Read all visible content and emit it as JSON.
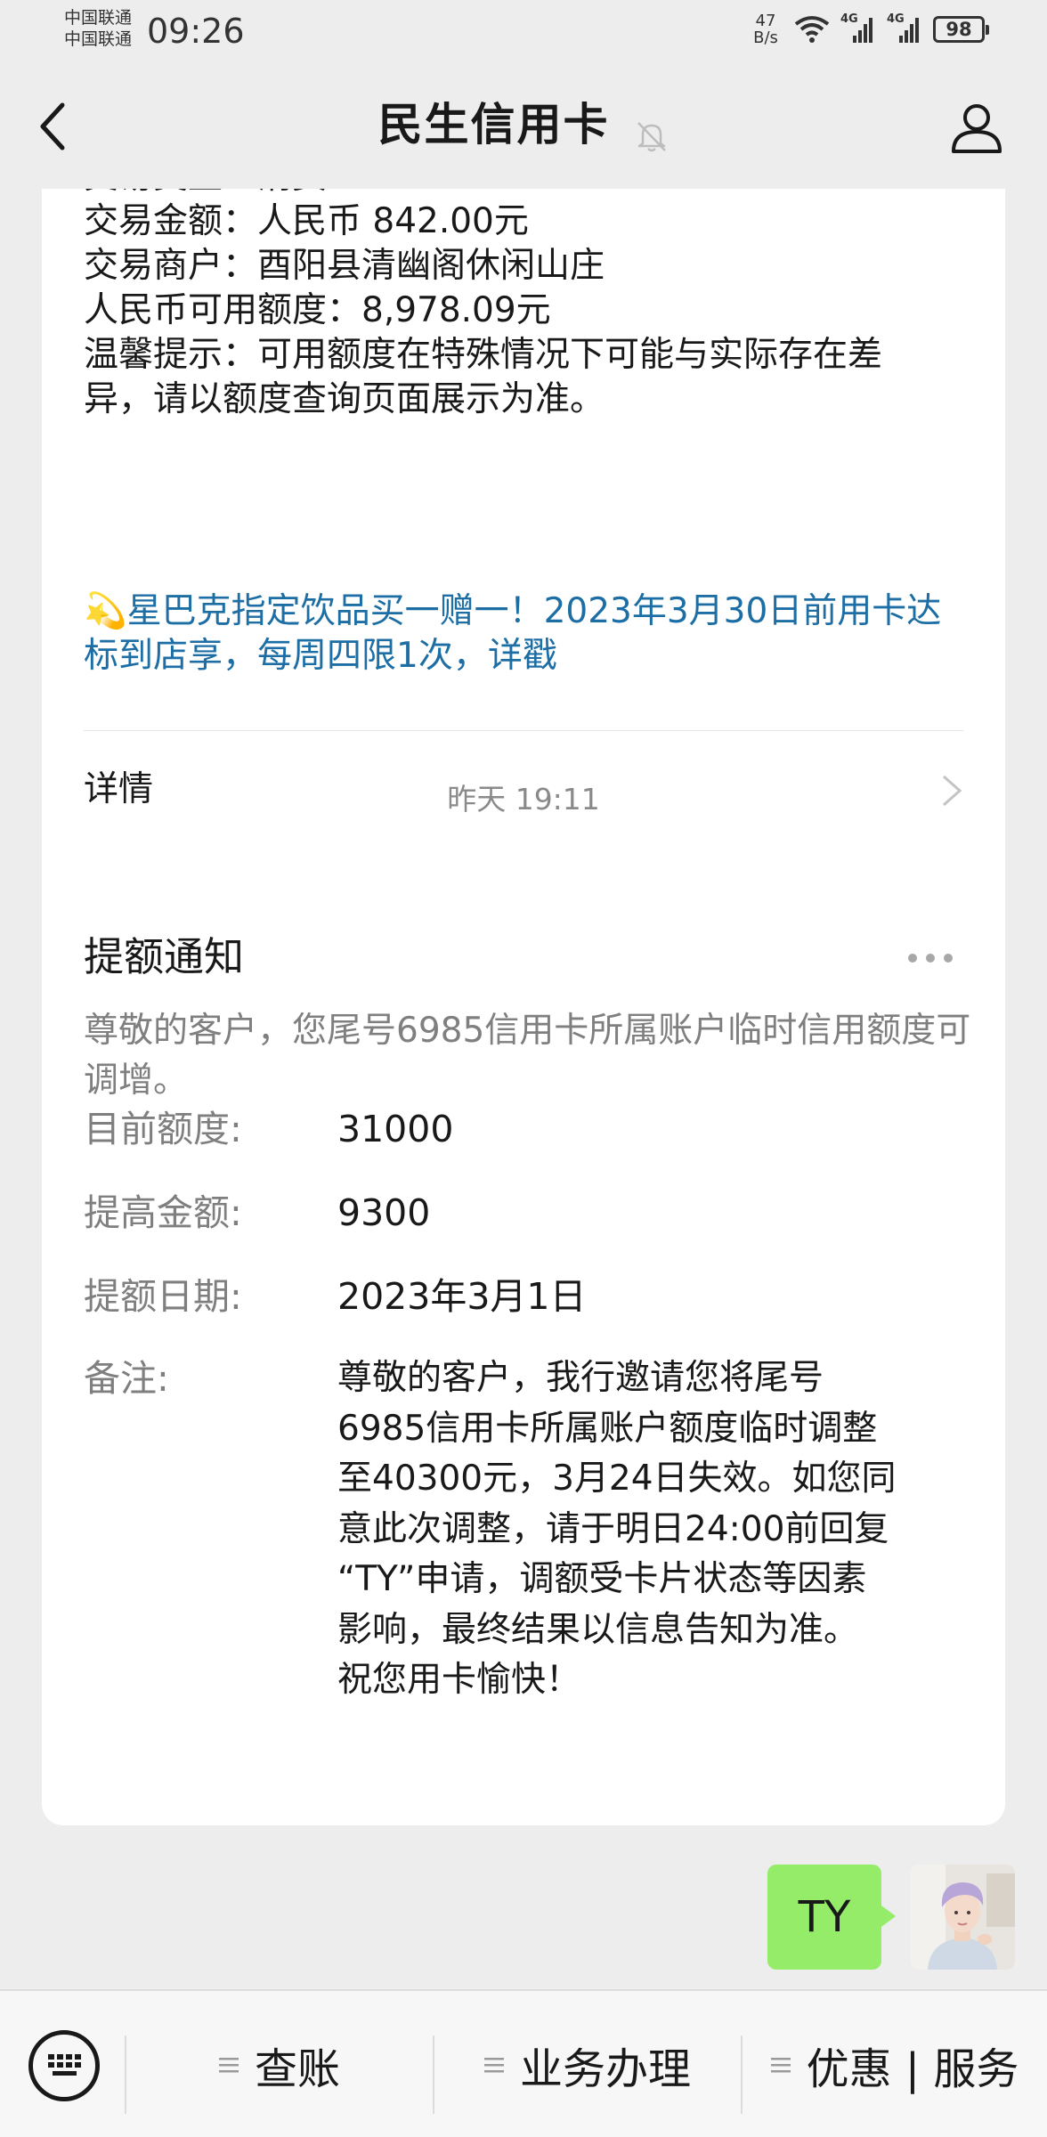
{
  "status_bar": {
    "carrier_1": "中国联通",
    "carrier_2": "中国联通",
    "time": "09:26",
    "net_speed_value": "47",
    "net_speed_unit": "B/s",
    "signal_1_label": "4G",
    "signal_2_label": "4G",
    "battery": "98"
  },
  "nav": {
    "title": "民生信用卡",
    "icons": [
      "back-icon",
      "mute-icon",
      "profile-icon"
    ]
  },
  "transaction_card": {
    "partial_top_line": "交易类型：消费",
    "lines": [
      "交易金额：人民币 842.00元",
      "交易商户：酉阳县清幽阁休闲山庄",
      "人民币可用额度：8,978.09元",
      "温馨提示：可用额度在特殊情况下可能与实际存在差",
      "异，请以额度查询页面展示为准。"
    ],
    "promo_emoji": "💫",
    "promo_text": "星巴克指定饮品买一赠一！2023年3月30日前用卡达标到店享，每周四限1次，详戳",
    "detail_label": "详情"
  },
  "timestamp": "昨天 19:11",
  "limit_card": {
    "title": "提额通知",
    "description": "尊敬的客户，您尾号6985信用卡所属账户临时信用额度可调增。",
    "fields": [
      {
        "label": "目前额度:",
        "value": "31000"
      },
      {
        "label": "提高金额:",
        "value": "9300"
      },
      {
        "label": "提额日期:",
        "value": "2023年3月1日"
      }
    ],
    "note_label": "备注:",
    "note_lines": [
      "尊敬的客户，我行邀请您将尾号",
      "6985信用卡所属账户额度临时调整",
      "至40300元，3月24日失效。如您同",
      "意此次调整，请于明日24:00前回复",
      "“TY”申请，调额受卡片状态等因素",
      "影响，最终结果以信息告知为准。",
      "祝您用卡愉快！"
    ]
  },
  "my_message": {
    "text": "TY"
  },
  "bottom_menu": {
    "items": [
      "查账",
      "业务办理",
      "优惠 | 服务"
    ]
  },
  "colors": {
    "background": "#ededed",
    "card": "#ffffff",
    "promo_link": "#1c6ea4",
    "my_bubble": "#95ec69",
    "secondary_text": "#7f7f7f"
  }
}
